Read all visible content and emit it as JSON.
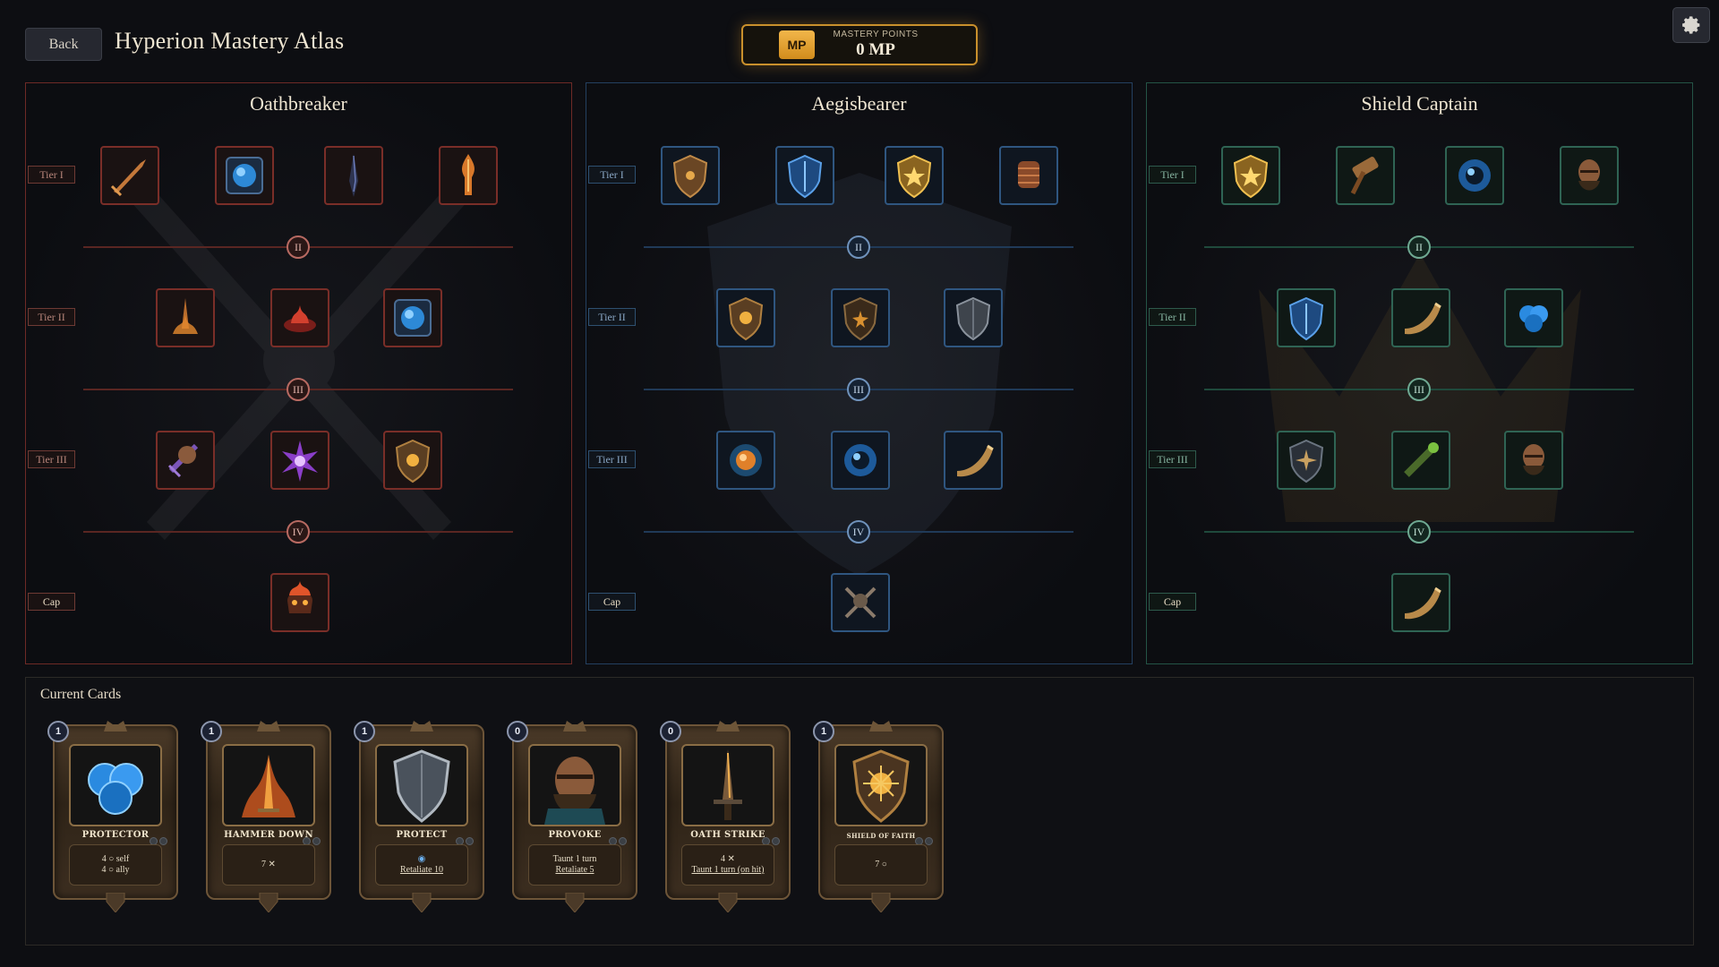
{
  "header": {
    "back_label": "Back",
    "title": "Hyperion Mastery Atlas",
    "mastery_badge": "MP",
    "mastery_label": "MASTERY POINTS",
    "mastery_value": "0 MP",
    "settings_icon": "gear-icon"
  },
  "colors": {
    "oathbreaker": "#b0443a",
    "aegisbearer": "#4f7fb5",
    "shield_captain": "#3f9a7d",
    "mastery_accent": "#d9982c"
  },
  "trees": [
    {
      "name": "Oathbreaker",
      "tiers": [
        "Tier I",
        "Tier II",
        "Tier III",
        "Cap"
      ],
      "markers": [
        "II",
        "III",
        "IV"
      ],
      "nodes": {
        "tier1": [
          "sword-slash-icon",
          "blue-orb-rune-icon",
          "dark-blade-icon",
          "flame-sword-icon"
        ],
        "tier2": [
          "burning-sword-icon",
          "fire-bowl-icon",
          "blue-orb-rune-icon"
        ],
        "tier3": [
          "purple-fist-icon",
          "purple-burst-icon",
          "sun-shield-icon"
        ],
        "cap": [
          "flaming-skull-icon"
        ]
      }
    },
    {
      "name": "Aegisbearer",
      "tiers": [
        "Tier I",
        "Tier II",
        "Tier III",
        "Cap"
      ],
      "markers": [
        "II",
        "III",
        "IV"
      ],
      "nodes": {
        "tier1": [
          "bronze-shield-icon",
          "blue-shield-icon",
          "gold-shield-icon",
          "gauntlet-icon"
        ],
        "tier2": [
          "sun-shield-icon",
          "star-shield-icon",
          "steel-shield-icon"
        ],
        "tier3": [
          "amber-orb-icon",
          "blue-orb-icon",
          "war-horn-icon"
        ],
        "cap": [
          "crossed-axes-skull-icon"
        ]
      }
    },
    {
      "name": "Shield Captain",
      "tiers": [
        "Tier I",
        "Tier II",
        "Tier III",
        "Cap"
      ],
      "markers": [
        "II",
        "III",
        "IV"
      ],
      "nodes": {
        "tier1": [
          "gold-shield-icon",
          "hammer-icon",
          "blue-orb-icon",
          "warrior-portrait-icon"
        ],
        "tier2": [
          "blue-shield-icon",
          "war-horn-icon",
          "blue-bubbles-icon"
        ],
        "tier3": [
          "compass-shield-icon",
          "spyglass-icon",
          "warrior-portrait-icon"
        ],
        "cap": [
          "war-horn-icon"
        ]
      }
    }
  ],
  "cards_section": {
    "title": "Current Cards",
    "cards": [
      {
        "name": "PROTECTOR",
        "cost": "1",
        "art": "blue-bubbles-icon",
        "lines": [
          "4 ○ self",
          "4 ○ ally"
        ]
      },
      {
        "name": "HAMMER DOWN",
        "cost": "1",
        "art": "flame-sword-icon",
        "lines": [
          "7 ✕"
        ]
      },
      {
        "name": "PROTECT",
        "cost": "1",
        "art": "steel-shield-icon",
        "lines": [
          "◉",
          "Retaliate 10"
        ]
      },
      {
        "name": "PROVOKE",
        "cost": "0",
        "art": "warrior-portrait-icon",
        "lines": [
          "Taunt 1 turn",
          "Retaliate 5"
        ]
      },
      {
        "name": "OATH STRIKE",
        "cost": "0",
        "art": "dark-blade-icon",
        "lines": [
          "4 ✕",
          "Taunt 1 turn (on hit)"
        ]
      },
      {
        "name": "SHIELD OF FAITH",
        "cost": "1",
        "art": "sun-shield-icon",
        "lines": [
          "7 ○"
        ]
      }
    ]
  }
}
